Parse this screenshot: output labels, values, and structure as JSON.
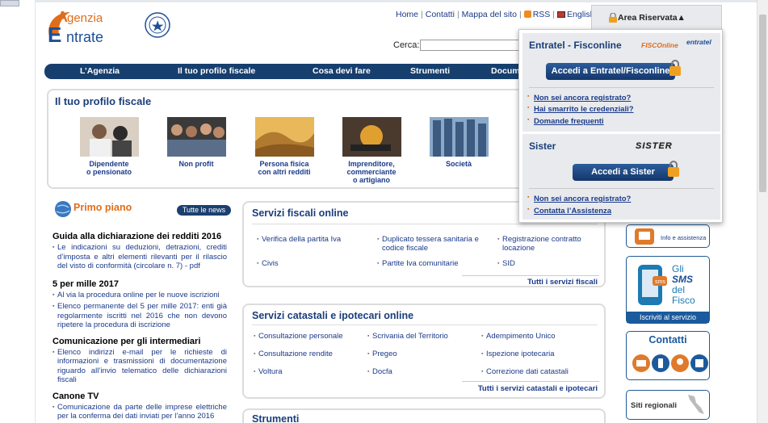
{
  "header": {
    "logo_line1": "genzia",
    "logo_letter_a": "A",
    "logo_line2": "ntrate",
    "logo_letter_e": "E",
    "links": [
      "Home",
      "Contatti",
      "Mappa del sito",
      "RSS",
      "English"
    ],
    "area_riservata": "Area Riservata",
    "search_label": "Cerca:"
  },
  "nav": [
    "L’Agenzia",
    "Il tuo profilo fiscale",
    "Cosa devi fare",
    "Strumenti",
    "Docum"
  ],
  "profilo": {
    "title": "Il tuo profilo fiscale",
    "items": [
      {
        "line1": "Dipendente",
        "line2": "o pensionato",
        "line3": ""
      },
      {
        "line1": "Non profit",
        "line2": "",
        "line3": ""
      },
      {
        "line1": "Persona fisica",
        "line2": "con altri redditi",
        "line3": ""
      },
      {
        "line1": "Imprenditore,",
        "line2": "commerciante",
        "line3": "o artigiano"
      },
      {
        "line1": "Società",
        "line2": "",
        "line3": ""
      }
    ]
  },
  "primo_piano": {
    "title": "Primo piano",
    "button": "Tutte le news",
    "news": [
      {
        "heading": "Guida alla dichiarazione dei redditi 2016",
        "items": [
          "Le indicazioni su deduzioni, detrazioni, crediti d’imposta e altri elementi rilevanti per il rilascio del visto di conformità (circolare n. 7) - pdf"
        ]
      },
      {
        "heading": "5 per mille 2017",
        "items": [
          "Al via la procedura online per le nuove iscrizioni",
          "Elenco permanente del 5 per mille 2017: enti già regolarmente iscritti nel 2016 che non devono ripetere la procedura di iscrizione"
        ]
      },
      {
        "heading": "Comunicazione per gli intermediari",
        "items": [
          "Elenco indirizzi e-mail per le richieste di informazioni e trasmissioni di documentazione riguardo all’invio telematico delle dichiarazioni fiscali"
        ]
      },
      {
        "heading": "Canone TV",
        "items": [
          "Comunicazione da parte delle imprese elettriche per la conferma dei dati inviati per l’anno 2016"
        ]
      }
    ]
  },
  "servizi_fiscali": {
    "title": "Servizi fiscali online",
    "items": [
      "Verifica della partita Iva",
      "Duplicato tessera sanitaria e codice fiscale",
      "Registrazione contratto locazione",
      "Civis",
      "Partite Iva comunitarie",
      "SID"
    ],
    "all_link": "Tutti i servizi fiscali"
  },
  "servizi_catastali": {
    "title": "Servizi catastali e ipotecari online",
    "items": [
      "Consultazione personale",
      "Scrivania del Territorio",
      "Adempimento Unico",
      "Consultazione rendite",
      "Pregeo",
      "Ispezione ipotecaria",
      "Voltura",
      "Docfa",
      "Correzione dati catastali"
    ],
    "all_link": "Tutti i servizi catastali e ipotecari"
  },
  "strumenti": {
    "title": "Strumenti"
  },
  "right_col": {
    "info_label": "Info e assistenza",
    "sms_line1": "Gli",
    "sms_line2": "SMS",
    "sms_line3": "del",
    "sms_line4": "Fisco",
    "sms_button": "Iscriviti al servizio",
    "contatti": "Contatti",
    "siti_regionali": "Siti regionali"
  },
  "area_riservata_menu": {
    "entratel_title": "Entratel - Fisconline",
    "entratel_button": "Accedi a Entratel/Fisconline",
    "entratel_links": [
      "Non sei ancora registrato?",
      "Hai smarrito le credenziali?",
      "Domande frequenti"
    ],
    "fisconline_logo": "FISCOnline",
    "entratel_logo": "entratel",
    "sister_title": "Sister",
    "sister_logo": "SISTER",
    "sister_button": "Accedi a Sister",
    "sister_links": [
      "Non sei ancora registrato?",
      "Contatta l’Assistenza"
    ]
  },
  "colors": {
    "nav_bg": "#173f6e",
    "accent_orange": "#e06d1b",
    "link_blue": "#1a3a8a"
  }
}
